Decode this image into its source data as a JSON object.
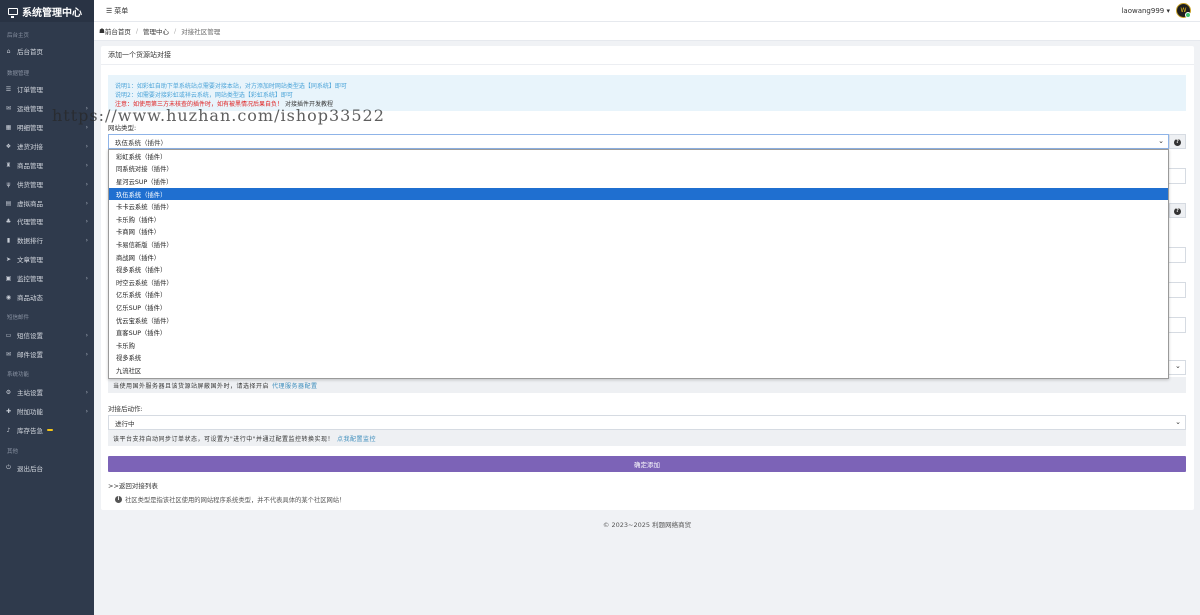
{
  "brand": {
    "title": "系统管理中心"
  },
  "sidebar": {
    "sections": [
      {
        "label": "后台主页",
        "items": [
          {
            "label": "后台首页",
            "icon": "home-icon",
            "glyph": "⌂",
            "arrow": false
          }
        ]
      },
      {
        "label": "数据管理",
        "items": [
          {
            "label": "订单管理",
            "icon": "list-icon",
            "glyph": "☰",
            "arrow": false
          },
          {
            "label": "运维管理",
            "icon": "chat-icon",
            "glyph": "✉",
            "arrow": true
          },
          {
            "label": "明细管理",
            "icon": "calendar-icon",
            "glyph": "▦",
            "arrow": true
          },
          {
            "label": "进货对接",
            "icon": "cubes-icon",
            "glyph": "❖",
            "arrow": true
          },
          {
            "label": "商品管理",
            "icon": "cart-icon",
            "glyph": "♜",
            "arrow": true
          },
          {
            "label": "供货管理",
            "icon": "cutlery-icon",
            "glyph": "ψ",
            "arrow": true
          },
          {
            "label": "虚拟商品",
            "icon": "book-icon",
            "glyph": "▤",
            "arrow": true
          },
          {
            "label": "代理管理",
            "icon": "sitemap-icon",
            "glyph": "♣",
            "arrow": true
          },
          {
            "label": "数据排行",
            "icon": "bar-chart-icon",
            "glyph": "▮",
            "arrow": true
          },
          {
            "label": "文章管理",
            "icon": "send-icon",
            "glyph": "➤",
            "arrow": false
          },
          {
            "label": "监控管理",
            "icon": "monitor-icon",
            "glyph": "▣",
            "arrow": true
          },
          {
            "label": "商品动态",
            "icon": "signal-icon",
            "glyph": "◉",
            "arrow": false
          }
        ]
      },
      {
        "label": "短信邮件",
        "items": [
          {
            "label": "短信设置",
            "icon": "sms-icon",
            "glyph": "▭",
            "arrow": true
          },
          {
            "label": "邮件设置",
            "icon": "envelope-icon",
            "glyph": "✉",
            "arrow": true
          }
        ]
      },
      {
        "label": "系统功能",
        "items": [
          {
            "label": "主站设置",
            "icon": "gear-icon",
            "glyph": "⚙",
            "arrow": true
          },
          {
            "label": "附加功能",
            "icon": "puzzle-icon",
            "glyph": "✚",
            "arrow": true
          },
          {
            "label": "库存告急",
            "icon": "bell-icon",
            "glyph": "♪",
            "arrow": false,
            "badge": true
          }
        ]
      },
      {
        "label": "其他",
        "items": [
          {
            "label": "退出后台",
            "icon": "power-icon",
            "glyph": "⏻",
            "arrow": false
          }
        ]
      }
    ]
  },
  "topbar": {
    "menu_label": "菜单",
    "username": "laowang999",
    "avatar_text": "W"
  },
  "breadcrumb": {
    "home": "前台首页",
    "parent": "管理中心",
    "current": "对接社区管理"
  },
  "card": {
    "title": "添加一个货源站对接",
    "notice": {
      "line1_a": "说明1：如彩虹自助下单系统站点需要对接本站，对方添加时网站类型选【同系统】即可",
      "line2_a": "说明2：如需要对接彩虹或祥云系统，网站类型选【彩虹系统】即可",
      "line3_red": "注意：如使用第三方未核查的插件时，如有被黑情况后果自负！",
      "line3_link": "对接插件开发教程"
    },
    "site_type_label": "网站类型:",
    "site_type_value": "玖伍系统（插件）",
    "site_type_options": [
      "彩虹系统（插件）",
      "同系统对接（插件）",
      "星河云SUP（插件）",
      "玖伍系统（插件）",
      "卡卡云系统（插件）",
      "卡乐购（插件）",
      "卡商网（插件）",
      "卡易信新版（插件）",
      "商战网（插件）",
      "视多系统（插件）",
      "时空云系统（插件）",
      "亿乐系统（插件）",
      "亿乐SUP（插件）",
      "优云宝系统（插件）",
      "直客SUP（插件）",
      "卡乐购",
      "视多系统",
      "九流社区"
    ],
    "selected_index": 3,
    "proxy_note": "当使用国外服务器且该货源站屏蔽国外时，请选择开启",
    "proxy_link": "代理服务器配置",
    "after_action_label": "对接后动作:",
    "after_action_value": "进行中",
    "after_action_note": "该平台支持自动同步订单状态，可设置为\"进行中\"并通过配置监控转换实现！",
    "after_action_link": "点我配置监控",
    "submit_label": "确定添加",
    "back_link": ">>返回对接列表",
    "tip": "社区类型是指该社区使用的网站程序系统类型，并不代表具体的某个社区网站！"
  },
  "footer": {
    "text": "© 2023~2025 利题网络商贸"
  },
  "watermark": {
    "text": "https://www.huzhan.com/ishop33522"
  },
  "colors": {
    "sidebar_bg": "#2f3a4c",
    "accent_button": "#7c63b7",
    "selected_option": "#1f6fd0",
    "notice_text": "#4aa3d8"
  }
}
